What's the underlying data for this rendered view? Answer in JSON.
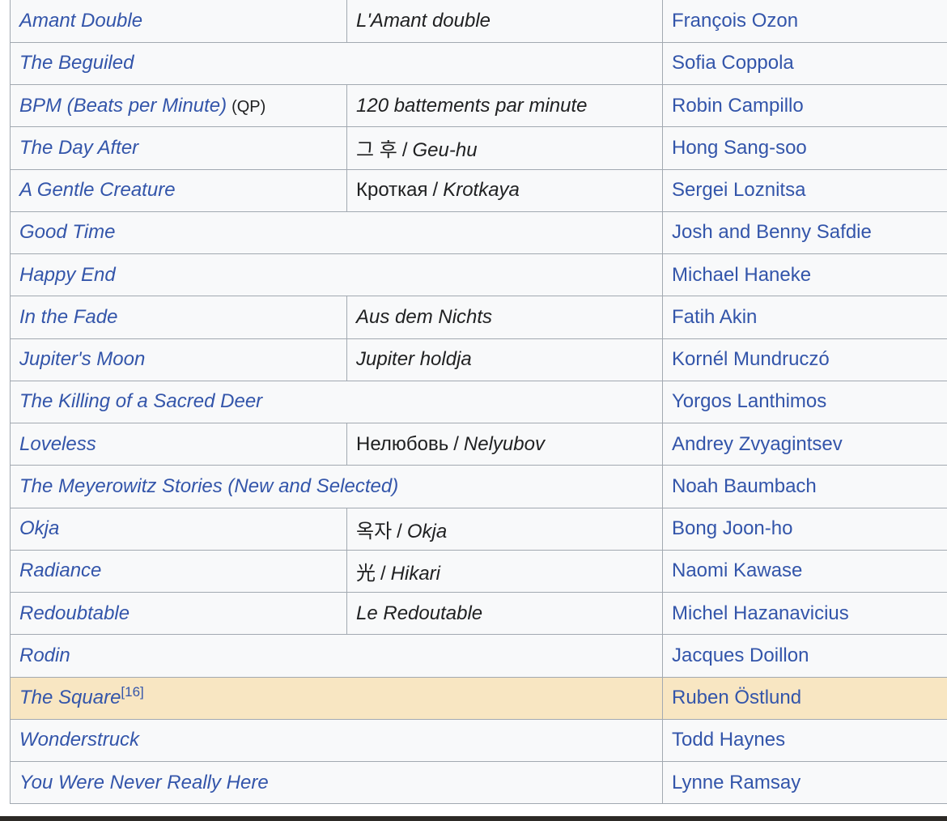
{
  "films": [
    {
      "title": "Amant Double",
      "original_script": "",
      "original_latin": "L'Amant double",
      "director": "François Ozon"
    },
    {
      "title": "The Beguiled",
      "director": "Sofia Coppola"
    },
    {
      "title": "BPM (Beats per Minute)",
      "note": "(QP)",
      "original_script": "",
      "original_latin": "120 battements par minute",
      "director": "Robin Campillo"
    },
    {
      "title": "The Day After",
      "original_script": "그 후",
      "original_latin": "Geu-hu",
      "director": "Hong Sang-soo"
    },
    {
      "title": "A Gentle Creature",
      "original_script": "Кроткая",
      "original_latin": "Krotkaya",
      "director": "Sergei Loznitsa"
    },
    {
      "title": "Good Time",
      "director": "Josh and Benny Safdie"
    },
    {
      "title": "Happy End",
      "director": "Michael Haneke"
    },
    {
      "title": "In the Fade",
      "original_script": "",
      "original_latin": "Aus dem Nichts",
      "director": "Fatih Akin"
    },
    {
      "title": "Jupiter's Moon",
      "original_script": "",
      "original_latin": "Jupiter holdja",
      "director": "Kornél Mundruczó"
    },
    {
      "title": "The Killing of a Sacred Deer",
      "director": "Yorgos Lanthimos"
    },
    {
      "title": "Loveless",
      "original_script": "Нелюбовь",
      "original_latin": "Nelyubov",
      "director": "Andrey Zvyagintsev"
    },
    {
      "title": "The Meyerowitz Stories (New and Selected)",
      "director": "Noah Baumbach"
    },
    {
      "title": "Okja",
      "original_script": "옥자",
      "original_latin": "Okja",
      "director": "Bong Joon-ho"
    },
    {
      "title": "Radiance",
      "original_script": "光",
      "original_latin": "Hikari",
      "director": "Naomi Kawase"
    },
    {
      "title": "Redoubtable",
      "original_script": "",
      "original_latin": "Le Redoutable",
      "director": "Michel Hazanavicius"
    },
    {
      "title": "Rodin",
      "director": "Jacques Doillon"
    },
    {
      "title": "The Square",
      "ref": "[16]",
      "director": "Ruben Östlund",
      "highlighted": true
    },
    {
      "title": "Wonderstruck",
      "director": "Todd Haynes"
    },
    {
      "title": "You Were Never Really Here",
      "director": "Lynne Ramsay"
    }
  ],
  "separator": "/",
  "colors": {
    "link": "#3355aa",
    "highlight_row": "#f8e6c2",
    "cell_background": "#f8f9fa",
    "border": "#a2a9b1"
  }
}
